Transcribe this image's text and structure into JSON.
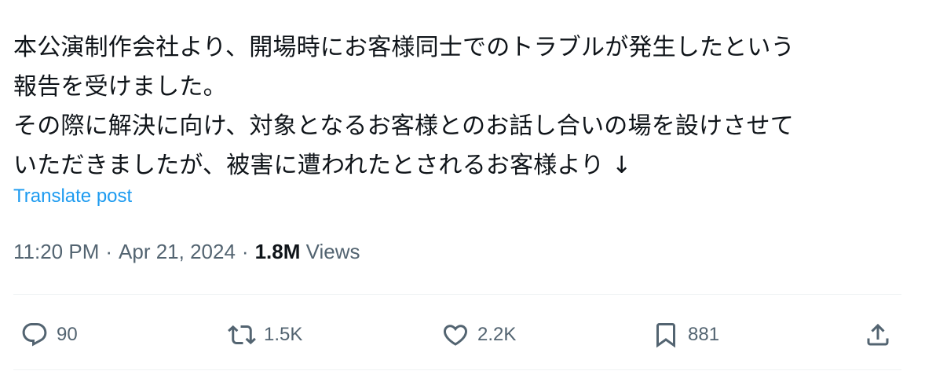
{
  "post": {
    "lines": [
      "本公演制作会社より、開場時にお客様同士でのトラブルが発生したという",
      "報告を受けました。",
      "その際に解決に向け、対象となるお客様とのお話し合いの場を設けさせて",
      "いただきましたが、被害に遭われたとされるお客様より ↓"
    ],
    "translate_label": "Translate post",
    "time": "11:20 PM",
    "separator": "·",
    "date": "Apr 21, 2024",
    "views_count": "1.8M",
    "views_label": "Views"
  },
  "actions": {
    "reply_count": "90",
    "repost_count": "1.5K",
    "like_count": "2.2K",
    "bookmark_count": "881"
  },
  "colors": {
    "link": "#1d9bf0",
    "secondary_text": "#536471",
    "primary_text": "#0f1419"
  }
}
